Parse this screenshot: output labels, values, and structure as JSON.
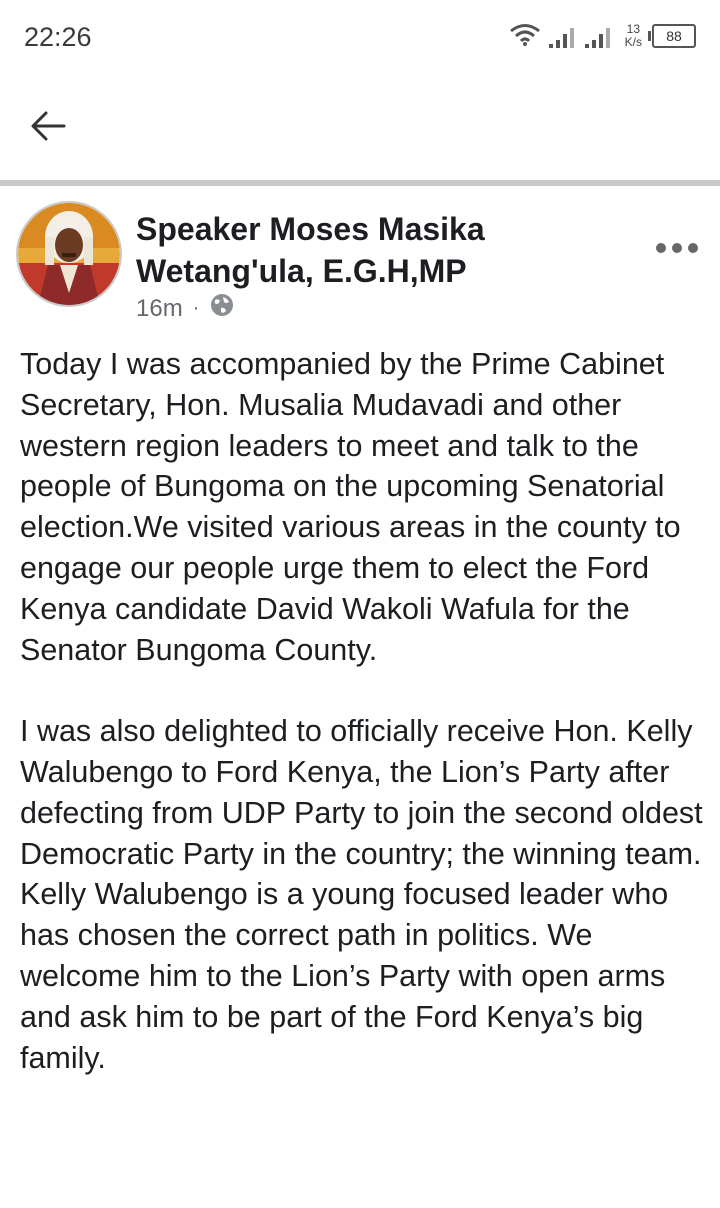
{
  "status_bar": {
    "time": "22:26",
    "wifi_icon": "wifi-icon",
    "signal_icon": "signal-bars-icon",
    "network_speed_value": "13",
    "network_speed_unit": "K/s",
    "battery_level": "88"
  },
  "app_bar": {
    "back_icon": "arrow-left-icon"
  },
  "post": {
    "author": "Speaker Moses Masika Wetang'ula, E.G.H,MP",
    "time_ago": "16m",
    "separator": "·",
    "privacy_icon": "globe-icon",
    "more_icon": "more-horizontal-icon",
    "text": "Today I was accompanied by the Prime Cabinet Secretary, Hon. Musalia Mudavadi and other western region leaders to meet and talk to the people of Bungoma on the upcoming Senatorial election.We visited various areas in the county to engage our people urge them to elect the Ford Kenya candidate David Wakoli Wafula for the Senator Bungoma County.\n\nI was also delighted to officially receive Hon. Kelly Walubengo to Ford Kenya, the Lion’s Party after defecting from UDP Party to join the second oldest Democratic Party in the country; the winning team.\nKelly Walubengo is a young focused leader who has chosen the correct path in politics. We welcome him to the Lion’s Party with open arms and ask him to be part of the Ford Kenya’s big family."
  },
  "colors": {
    "text_primary": "#1c1e21",
    "text_secondary": "#65676b",
    "divider": "#c8c9cb"
  }
}
